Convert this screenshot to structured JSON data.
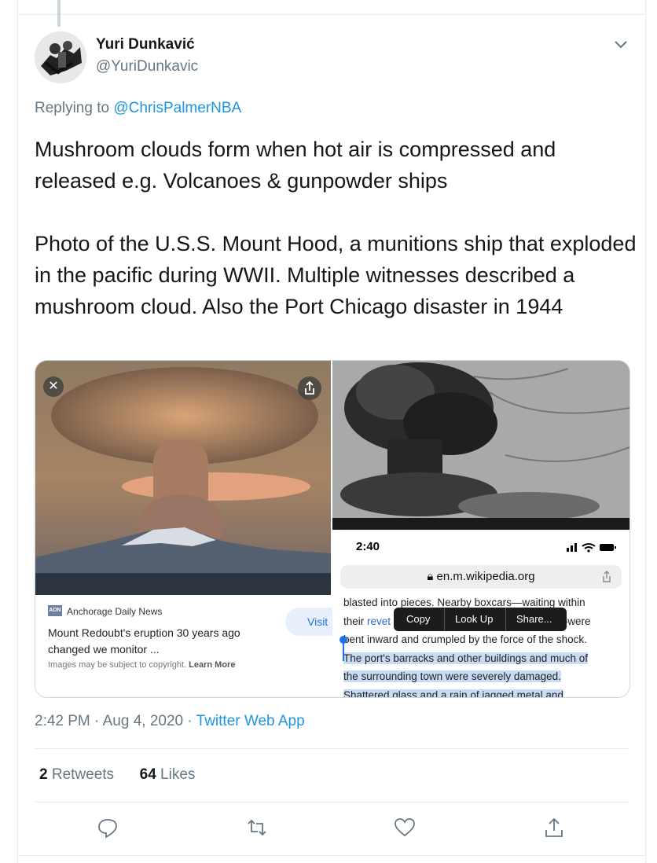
{
  "tweet": {
    "author_name": "Yuri Dunkavić",
    "author_handle": "@YuriDunkavic",
    "reply_prefix": "Replying to ",
    "reply_to": "@ChrisPalmerNBA",
    "paragraph_1": "Mushroom clouds form when hot air is compressed and released e.g. Volcanoes & gunpowder ships",
    "paragraph_2": "Photo of the U.S.S. Mount Hood, a munitions ship that exploded in the pacific during WWII. Multiple witnesses described a mushroom cloud. Also the Port Chicago disaster in 1944",
    "time": "2:42 PM",
    "date": "Aug 4, 2020",
    "separator": "·",
    "app": "Twitter Web App",
    "retweets_count": "2",
    "retweets_label": "Retweets",
    "likes_count": "64",
    "likes_label": "Likes"
  },
  "media_left": {
    "source": "Anchorage Daily News",
    "logo_text": "ADN",
    "title": "Mount Redoubt's eruption 30 years ago changed we monitor ...",
    "note": "Images may be subject to copyright.",
    "note_link": "Learn More",
    "visit_label": "Visit",
    "close_glyph": "✕"
  },
  "media_right": {
    "clock": "2:40",
    "url": "en.m.wikipedia.org",
    "line_1": "blasted into pieces. Nearby boxcars—waiting within",
    "line_2a": "their ",
    "line_2_link": "revet",
    "line_2b": "t—were",
    "line_3": "bent inward and crumpled by the force of the shock.",
    "line_4": "The port's barracks and other buildings and much of",
    "line_5": "the surrounding town were severely damaged.",
    "line_6": "Shattered glass and a rain of jagged metal and",
    "menu_copy": "Copy",
    "menu_lookup": "Look Up",
    "menu_share": "Share..."
  },
  "colors": {
    "accent": "#1b95e0",
    "muted": "#657786",
    "border": "#e6ecf0"
  },
  "icons": [
    "chevron-down-icon",
    "close-icon",
    "share-icon",
    "reply-icon",
    "retweet-icon",
    "like-icon",
    "share-tweet-icon",
    "lock-icon"
  ]
}
